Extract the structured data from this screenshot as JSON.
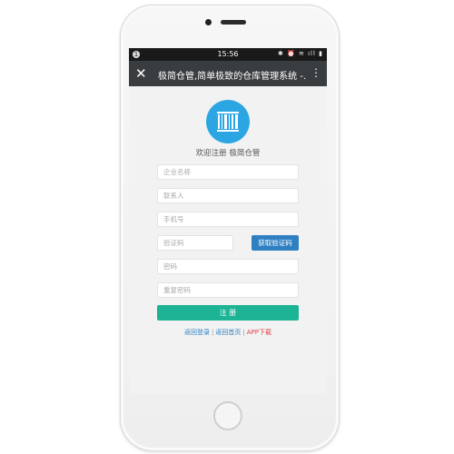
{
  "status_bar": {
    "time": "15:56",
    "notification_badge": "1",
    "icons": "✱ ⏰ ≋ ıll ▮"
  },
  "title_bar": {
    "close_label": "✕",
    "title": "极简仓管,简单极致的仓库管理系统 -...",
    "more_label": "⋮"
  },
  "logo": {
    "icon": "barcode-icon",
    "color": "#2ba6e3"
  },
  "welcome_text": "欢迎注册 极简仓管",
  "form": {
    "company_placeholder": "企业名称",
    "contact_placeholder": "联系人",
    "phone_placeholder": "手机号",
    "code_placeholder": "验证码",
    "get_code_button": "获取验证码",
    "password_placeholder": "密码",
    "repeat_password_placeholder": "重复密码",
    "register_button": "注 册"
  },
  "links": {
    "login": "返回登录",
    "home": "返回首页",
    "app_download": "APP下载",
    "separator": "|"
  },
  "colors": {
    "accent_blue": "#2f80c2",
    "register_green": "#1db395",
    "app_link_red": "#e3414a",
    "title_bar": "#393d3f"
  }
}
